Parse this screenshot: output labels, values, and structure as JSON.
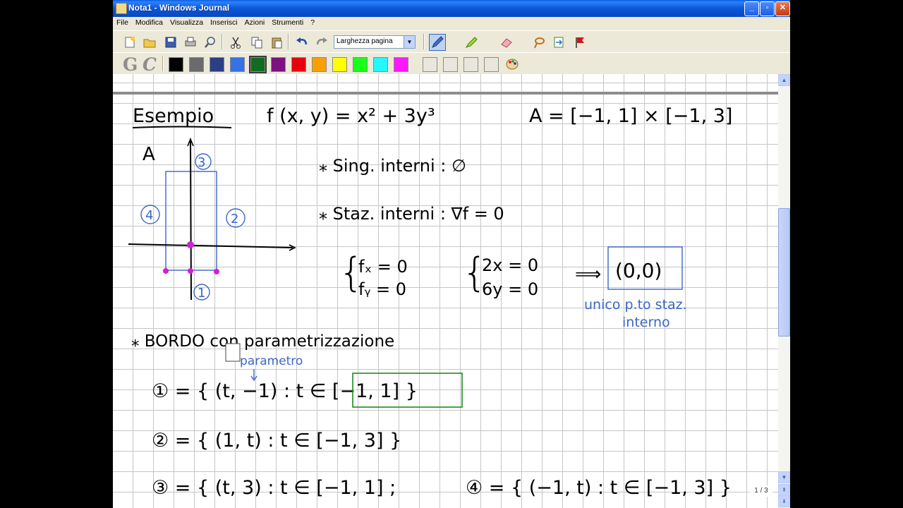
{
  "window": {
    "title": "Nota1 - Windows Journal"
  },
  "menu": [
    "File",
    "Modifica",
    "Visualizza",
    "Inserisci",
    "Azioni",
    "Strumenti",
    "?"
  ],
  "toolbar": {
    "zoom_value": "Larghezza pagina"
  },
  "formatting": {
    "bold_label": "G",
    "italic_label": "C"
  },
  "colors": [
    "#000000",
    "#6b6b6b",
    "#2c3e86",
    "#3672e6",
    "#126c1e",
    "#7e1180",
    "#e8000e",
    "#f7a100",
    "#ffff00",
    "#18ff1a",
    "#24f7ff",
    "#ff18ff"
  ],
  "pen_colors_selected_index": 4,
  "notes": {
    "title": "Esempio",
    "function": "f (x, y) = x² + 3y³",
    "domain": "A = [−1, 1] × [−1, 3]",
    "graph_label_A": "A",
    "region_labels": [
      "③",
      "④",
      "②",
      "①"
    ],
    "sing_interni": "⁎ Sing. interni : ∅",
    "staz_interni": "⁎ Staz. interni : ∇f = 0",
    "system1": [
      "fₓ = 0",
      "fᵧ = 0"
    ],
    "system2": [
      "2x = 0",
      "6y = 0"
    ],
    "arrow_result": "⟹",
    "result": "(0,0)",
    "result_note_1": "unico p.to staz.",
    "result_note_2": "interno",
    "bordo": "⁎ BORDO con parametrizzazione",
    "parametro": "parametro",
    "edge1": "① = { (t, −1) : t ∈ [−1, 1] }",
    "edge2": "② = { (1, t) : t ∈ [−1, 3] }",
    "edge3": "③ = { (t, 3) : t ∈ [−1, 1] ;",
    "edge4": "④ = { (−1, t) : t ∈ [−1, 3] }"
  },
  "page_indicator": "1 / 3"
}
